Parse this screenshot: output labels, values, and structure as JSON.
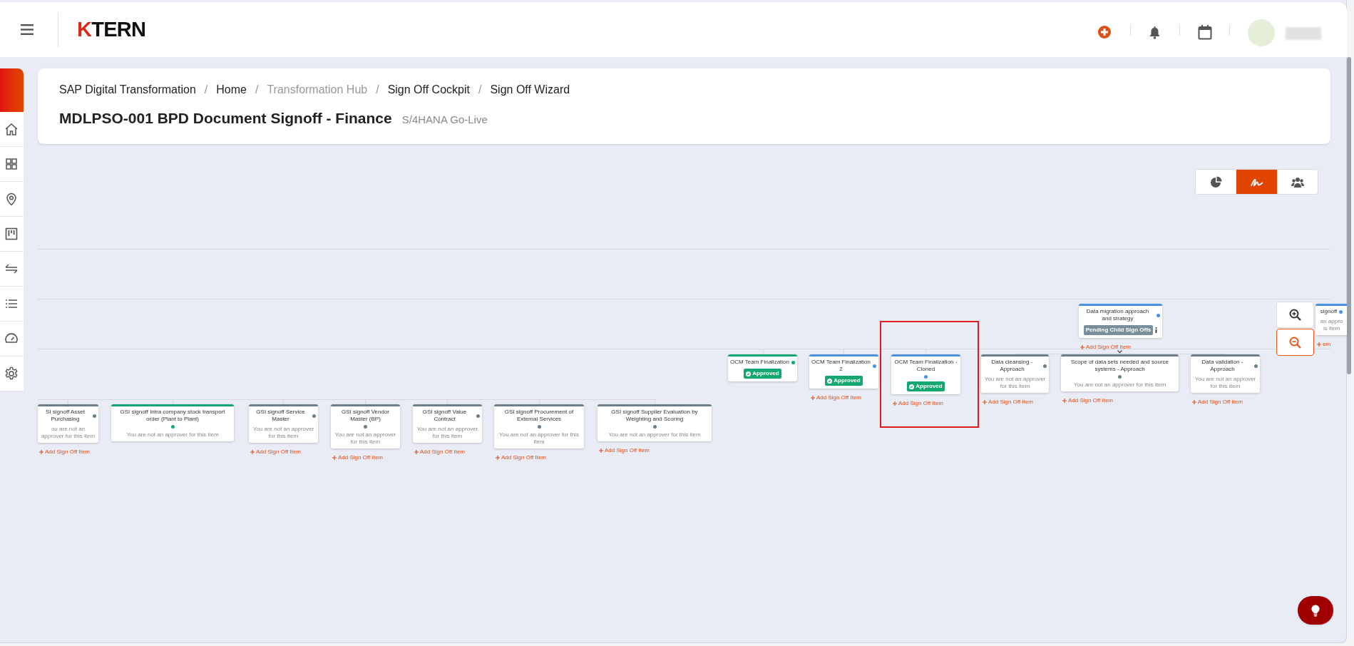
{
  "header": {
    "logo_mark": "K",
    "logo_text": "TERN"
  },
  "breadcrumbs": [
    {
      "label": "SAP Digital Transformation",
      "disabled": false
    },
    {
      "separator": "/",
      "label": "Home",
      "disabled": false
    },
    {
      "separator": "/",
      "label": "Transformation Hub",
      "disabled": true
    },
    {
      "separator": "/",
      "label": "Sign Off Cockpit",
      "disabled": false
    },
    {
      "separator": "/",
      "label": "Sign Off Wizard",
      "disabled": false
    }
  ],
  "page_title": "MDLPSO-001 BPD Document Signoff - Finance",
  "page_subtitle": "S/4HANA Go-Live",
  "view_toggles": [
    {
      "selected": false
    },
    {
      "selected": true
    },
    {
      "selected": false
    }
  ],
  "nodes": [
    {
      "title": "SI signoff Asset Purchasing",
      "color": "#6b7f8a",
      "kind": "not_approver",
      "text": "ou are not an approver for this item",
      "dot_below": false,
      "add_link": "Add Sign Off Item",
      "highlighted": false
    },
    {
      "title": "GSI signoff Intra company stock transport order (Plant to Plant)",
      "color": "#13a870",
      "kind": "not_approver",
      "text": "You are not an approver for this item",
      "dot_below": true,
      "highlighted": false
    },
    {
      "title": "GSI signoff Service Master",
      "color": "#6b7f8a",
      "kind": "not_approver",
      "text": "You are not an approver for this item",
      "dot_below": false,
      "add_link": "Add Sign Off Item",
      "highlighted": false
    },
    {
      "title": "GSI signoff Vendor Master (BP)",
      "color": "#6b7f8a",
      "kind": "not_approver",
      "text": "You are not an approver for this item",
      "dot_below": true,
      "add_link": "Add Sign Off Item",
      "highlighted": false
    },
    {
      "title": "GSI signoff Value Contract",
      "color": "#6b7f8a",
      "kind": "not_approver",
      "text": "You are not an approver for this item",
      "dot_below": false,
      "add_link": "Add Sign Off Item",
      "highlighted": false
    },
    {
      "title": "GSI signoff Procurement of External Services",
      "color": "#6b7f8a",
      "kind": "not_approver",
      "text": "You are not an approver for this item",
      "dot_below": true,
      "add_link": "Add Sign Off Item",
      "highlighted": false
    },
    {
      "title": "GSI signoff Supplier Evaluation by Weighting and Scoring",
      "color": "#6b7f8a",
      "kind": "not_approver",
      "text": "You are not an approver for this item",
      "dot_below": true,
      "add_link": "Add Sign Off Item",
      "highlighted": false
    },
    {
      "title": "OCM Team Finalization",
      "color": "#13a870",
      "kind": "approved",
      "text": "Approved",
      "dot_below": false,
      "highlighted": false
    },
    {
      "title": "OCM Team Finalization 2",
      "color": "#4a90e2",
      "kind": "approved",
      "text": "Approved",
      "dot_below": false,
      "add_link": "Add Sign Off Item",
      "highlighted": false
    },
    {
      "title": "OCM Team Finalization - Cloned",
      "color": "#4a90e2",
      "kind": "approved",
      "text": "Approved",
      "dot_below": true,
      "add_link": "Add Sign Off Item",
      "highlighted": true
    },
    {
      "title": "Data cleansing - Approach",
      "color": "#6b7f8a",
      "kind": "not_approver",
      "text": "You are not an approver for this item",
      "dot_below": false,
      "add_link": "Add Sign Off Item",
      "highlighted": false
    },
    {
      "title": "Scope of data sets needed and source systems - Approach",
      "color": "#6b7f8a",
      "kind": "not_approver",
      "text": "You are not an approver for this item",
      "dot_below": true,
      "add_link": "Add Sign Off Item",
      "highlighted": false
    },
    {
      "title": "Data validation - Approach",
      "color": "#6b7f8a",
      "kind": "not_approver",
      "text": "You are not an approver for this item",
      "dot_below": false,
      "add_link": "Add Sign Off Item",
      "highlighted": false
    },
    {
      "title": "Data migration approach and strategy",
      "color": "#4a90e2",
      "kind": "pending",
      "text": "Pending Child Sign Offs",
      "dot_below": false,
      "add_link": "Add Sign Off Item",
      "highlighted": false
    },
    {
      "title": "signoff",
      "color": "#4a90e2",
      "kind": "not_approver",
      "text": "an appro\nis item",
      "dot_below": false,
      "add_link": "em",
      "highlighted": false
    }
  ]
}
